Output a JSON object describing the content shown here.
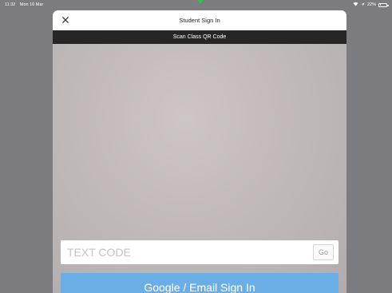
{
  "status_bar": {
    "time": "11:32",
    "date": "Mon 16 Mar",
    "wifi_icon": "wifi-icon",
    "location_icon": "location-arrow-icon",
    "battery_percent": "22%",
    "battery_level": 0.22
  },
  "modal": {
    "title": "Student Sign In",
    "close_icon": "close-icon",
    "scan_label": "Scan Class QR Code"
  },
  "code_entry": {
    "placeholder": "TEXT CODE",
    "value": "",
    "go_label": "Go"
  },
  "google_button": {
    "label": "Google / Email Sign In"
  },
  "colors": {
    "background": "#7c7c80",
    "scan_bar": "#262626",
    "google_button": "#6baee6",
    "indicator": "#2ec24b"
  }
}
